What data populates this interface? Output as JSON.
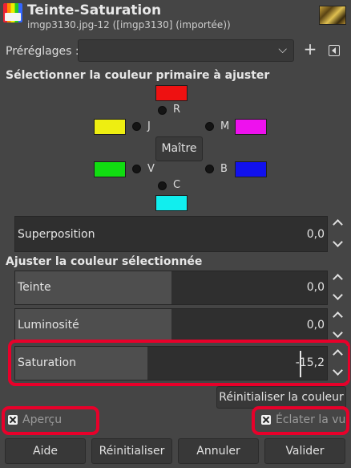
{
  "header": {
    "title": "Teinte-Saturation",
    "subtitle": "imgp3130.jpg-12 ([imgp3130] (importée))"
  },
  "presets": {
    "label": "Préréglages :",
    "value": "",
    "add_symbol": "+"
  },
  "color_select": {
    "section_title": "Sélectionner la couleur primaire à ajuster",
    "master_label": "Maître",
    "colors": [
      {
        "id": "R",
        "label": "R",
        "hex": "#ee1111"
      },
      {
        "id": "J",
        "label": "J",
        "hex": "#eeee11"
      },
      {
        "id": "M",
        "label": "M",
        "hex": "#ee11ee"
      },
      {
        "id": "V",
        "label": "V",
        "hex": "#11dd11"
      },
      {
        "id": "B",
        "label": "B",
        "hex": "#1111ee"
      },
      {
        "id": "C",
        "label": "C",
        "hex": "#11eeee"
      }
    ]
  },
  "overlap": {
    "label": "Superposition",
    "value": "0,0",
    "fill_fraction": 0.0
  },
  "adjust": {
    "section_title": "Ajuster la couleur sélectionnée",
    "hue": {
      "label": "Teinte",
      "value": "0,0",
      "fill_fraction": 0.5
    },
    "lightness": {
      "label": "Luminosité",
      "value": "0,0",
      "fill_fraction": 0.5
    },
    "saturation": {
      "label": "Saturation",
      "value": "-15,2",
      "fill_fraction": 0.424
    },
    "reset_color_label": "Réinitialiser la couleur"
  },
  "options": {
    "preview_label": "Aperçu",
    "split_view_label": "Éclater la vue"
  },
  "buttons": {
    "help": "Aide",
    "reset": "Réinitialiser",
    "cancel": "Annuler",
    "ok": "Valider"
  },
  "accent": {
    "highlight": "#e8002a"
  }
}
